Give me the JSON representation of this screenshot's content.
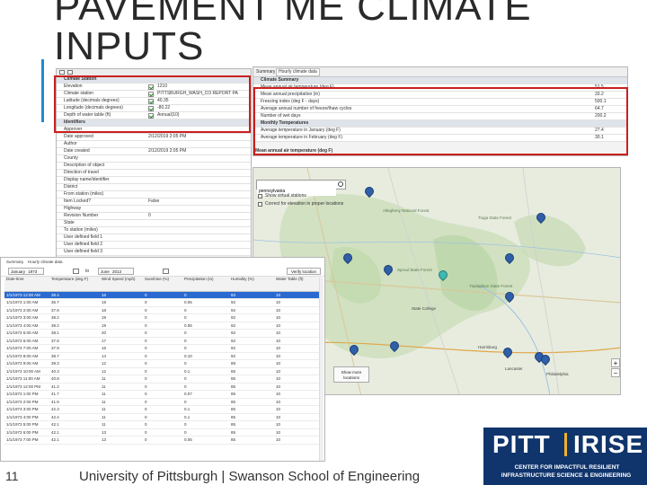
{
  "slide": {
    "title_line1": "PAVEMENT ME CLIMATE",
    "title_line2": "INPUTS",
    "page_number": "11",
    "footer": "University of Pittsburgh | Swanson School of Engineering",
    "accent_color": "#1f8bd0",
    "highlight_color": "#cc1f1f"
  },
  "logo": {
    "pitt": "PITT",
    "irise": "IRISE",
    "line1": "CENTER FOR IMPACTFUL RESILIENT",
    "line2": "INFRASTRUCTURE SCIENCE & ENGINEERING"
  },
  "properties_panel": {
    "sections": [
      {
        "label": "Climate Station",
        "rows": [
          {
            "label": "Elevation",
            "value": "1210",
            "checked": true
          },
          {
            "label": "Climate station",
            "value": "PITTSBURGH_WASH_CO REPORT PA",
            "checked": true
          },
          {
            "label": "Latitude (decimals degrees)",
            "value": "40.35",
            "checked": true
          },
          {
            "label": "Longitude (decimals degrees)",
            "value": "-80.22",
            "checked": true
          },
          {
            "label": "Depth of water table (ft)",
            "value": "Annual(10)",
            "checked": true
          }
        ]
      },
      {
        "label": "Identifiers",
        "rows": [
          {
            "label": "Approver",
            "value": ""
          },
          {
            "label": "Date approved",
            "value": "2/12/2019 2:05 PM"
          },
          {
            "label": "Author",
            "value": ""
          },
          {
            "label": "Date created",
            "value": "2/12/2019 2:05 PM"
          },
          {
            "label": "County",
            "value": ""
          },
          {
            "label": "Description of object",
            "value": ""
          },
          {
            "label": "Direction of travel",
            "value": ""
          },
          {
            "label": "Display name/identifier",
            "value": ""
          },
          {
            "label": "District",
            "value": ""
          },
          {
            "label": "From station (miles)",
            "value": ""
          },
          {
            "label": "Item Locked?",
            "value": "False"
          },
          {
            "label": "Highway",
            "value": ""
          },
          {
            "label": "Revision Number",
            "value": "0"
          },
          {
            "label": "State",
            "value": ""
          },
          {
            "label": "To station (miles)",
            "value": ""
          },
          {
            "label": "User defined field 1",
            "value": ""
          },
          {
            "label": "User defined field 2",
            "value": ""
          },
          {
            "label": "User defined field 3",
            "value": ""
          }
        ]
      }
    ]
  },
  "summary_window": {
    "tabs": [
      "Summary",
      "Hourly climate data"
    ],
    "sections": [
      {
        "label": "Climate Summary",
        "rows": [
          {
            "label": "Mean annual air temperature (deg F)",
            "value": "51.5"
          },
          {
            "label": "Mean annual precipitation (in)",
            "value": "33.2"
          },
          {
            "label": "Freezing index (deg F - days)",
            "value": "500.1"
          },
          {
            "label": "Average annual number of freeze/thaw cycles",
            "value": "64.7"
          },
          {
            "label": "Number of wet days",
            "value": "200.2"
          }
        ]
      },
      {
        "label": "Monthly Temperatures",
        "rows": [
          {
            "label": "Average temperature in January (deg F)",
            "value": "27.4"
          },
          {
            "label": "Average temperature in February (deg F)",
            "value": "30.1"
          }
        ]
      }
    ],
    "footer_label": "Mean annual air temperature (deg F)"
  },
  "map_panel": {
    "search_value": "pennsylvania",
    "checkbox1": "Show virtual stations",
    "checkbox2": "Correct for elevation in proper locations",
    "show_more": "Show more locations",
    "zoom_in": "+",
    "zoom_out": "−",
    "place_labels": [
      "Allegheny National Forest",
      "Tioga State Forest",
      "Sproul State Forest",
      "Tiadaghton State Forest",
      "State College",
      "Harrisburg",
      "Pittsburgh",
      "Philadelphia",
      "Lancaster"
    ]
  },
  "hourly_panel": {
    "tabs": [
      "Summary",
      "Hourly climate data"
    ],
    "from_month": "January",
    "from_year": "1973",
    "to_label": "to",
    "to_month": "June",
    "to_year": "2013",
    "verify_button": "Verify location",
    "columns": [
      "Date-time",
      "Temperature (deg F)",
      "Wind Speed (mph)",
      "Sunshine (%)",
      "Precipitation (in)",
      "Humidity (%)",
      "Water Table (ft)"
    ],
    "rows": [
      [
        "1/1/1973 12:00 AM",
        "38.4",
        "16",
        "0",
        "0",
        "93",
        "10"
      ],
      [
        "1/1/1973 1:00 AM",
        "36.7",
        "19",
        "0",
        "0.05",
        "92",
        "10"
      ],
      [
        "1/1/1973 2:00 AM",
        "37.9",
        "18",
        "0",
        "0",
        "92",
        "10"
      ],
      [
        "1/1/1973 3:00 AM",
        "38.2",
        "19",
        "0",
        "0",
        "92",
        "10"
      ],
      [
        "1/1/1973 4:00 AM",
        "38.2",
        "19",
        "0",
        "0.05",
        "92",
        "10"
      ],
      [
        "1/1/1973 5:00 AM",
        "38.1",
        "20",
        "0",
        "0",
        "92",
        "10"
      ],
      [
        "1/1/1973 6:00 AM",
        "37.8",
        "17",
        "0",
        "0",
        "92",
        "10"
      ],
      [
        "1/1/1973 7:00 AM",
        "37.9",
        "16",
        "0",
        "0",
        "92",
        "10"
      ],
      [
        "1/1/1973 8:00 AM",
        "38.7",
        "14",
        "0",
        "0.10",
        "92",
        "10"
      ],
      [
        "1/1/1973 9:00 AM",
        "39.3",
        "12",
        "0",
        "0",
        "89",
        "10"
      ],
      [
        "1/1/1973 10:00 AM",
        "40.3",
        "12",
        "0",
        "0.1",
        "85",
        "10"
      ],
      [
        "1/1/1973 11:00 AM",
        "40.8",
        "11",
        "0",
        "0",
        "85",
        "10"
      ],
      [
        "1/1/1973 12:00 PM",
        "41.2",
        "11",
        "0",
        "0",
        "85",
        "10"
      ],
      [
        "1/1/1973 1:00 PM",
        "41.7",
        "11",
        "0",
        "0.07",
        "85",
        "10"
      ],
      [
        "1/1/1973 2:00 PM",
        "41.9",
        "11",
        "0",
        "0",
        "85",
        "10"
      ],
      [
        "1/1/1973 3:00 PM",
        "42.3",
        "11",
        "0",
        "0.1",
        "85",
        "10"
      ],
      [
        "1/1/1973 4:00 PM",
        "42.4",
        "11",
        "0",
        "0.1",
        "85",
        "10"
      ],
      [
        "1/1/1973 5:00 PM",
        "42.1",
        "11",
        "0",
        "0",
        "85",
        "10"
      ],
      [
        "1/1/1973 6:00 PM",
        "42.1",
        "13",
        "0",
        "0",
        "85",
        "10"
      ],
      [
        "1/1/1973 7:00 PM",
        "42.1",
        "13",
        "0",
        "0.05",
        "85",
        "10"
      ]
    ]
  }
}
